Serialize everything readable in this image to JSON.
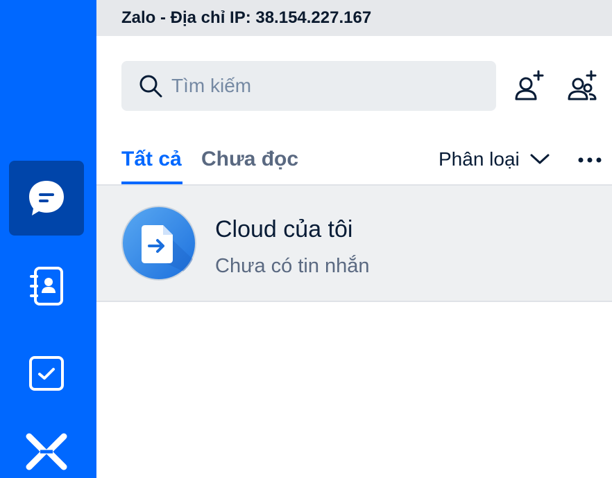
{
  "window": {
    "title": "Zalo - Địa chỉ IP: 38.154.227.167"
  },
  "sidebar": {
    "items": [
      {
        "name": "messages",
        "icon": "chat-bubble-icon",
        "active": true
      },
      {
        "name": "contacts",
        "icon": "contact-book-icon",
        "active": false
      },
      {
        "name": "todo",
        "icon": "checkbox-icon",
        "active": false
      },
      {
        "name": "zcloud",
        "icon": "zalo-logo-icon",
        "active": false
      }
    ]
  },
  "search": {
    "placeholder": "Tìm kiếm",
    "value": ""
  },
  "actions": {
    "add_friend_icon": "add-friend-icon",
    "create_group_icon": "create-group-icon"
  },
  "tabs": {
    "all": "Tất cả",
    "unread": "Chưa đọc",
    "active": "all"
  },
  "filter": {
    "label": "Phân loại"
  },
  "conversations": [
    {
      "name": "Cloud của tôi",
      "preview": "Chưa có tin nhắn",
      "avatar_icon": "cloud-file-icon"
    }
  ],
  "colors": {
    "brand": "#0068ff",
    "sidebar_active": "#0045aa",
    "titlebar": "#e6e8eb",
    "selected_row": "#eef0f2"
  }
}
